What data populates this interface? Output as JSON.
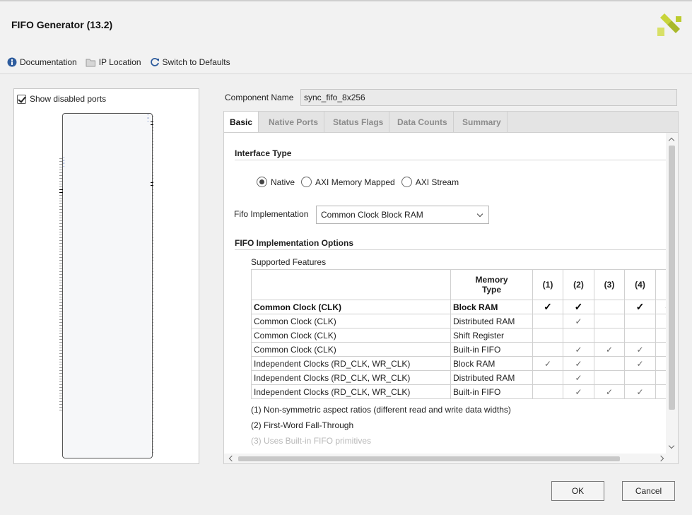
{
  "window": {
    "title": "FIFO Generator (13.2)"
  },
  "toolbar": {
    "documentation": "Documentation",
    "ip_location": "IP Location",
    "switch_defaults": "Switch to Defaults"
  },
  "left_panel": {
    "show_disabled_ports": "Show disabled ports",
    "show_disabled_checked": true
  },
  "component": {
    "label": "Component Name",
    "value": "sync_fifo_8x256"
  },
  "tabs": [
    "Basic",
    "Native Ports",
    "Status Flags",
    "Data Counts",
    "Summary"
  ],
  "basic": {
    "interface_type_title": "Interface Type",
    "interface_options": [
      "Native",
      "AXI Memory Mapped",
      "AXI Stream"
    ],
    "interface_selected": "Native",
    "impl_label": "Fifo Implementation",
    "impl_value": "Common Clock Block RAM",
    "options_title": "FIFO Implementation Options",
    "supported_features": "Supported Features",
    "table": {
      "headers": [
        "",
        "Memory",
        "Type",
        "(1)",
        "(2)",
        "(3)",
        "(4)",
        "("
      ],
      "rows": [
        {
          "clock": "Common Clock (CLK)",
          "memory": "Block RAM",
          "c1": "✓",
          "c2": "✓",
          "c3": "",
          "c4": "✓",
          "c5": "✓"
        },
        {
          "clock": "Common Clock (CLK)",
          "memory": "Distributed RAM",
          "c1": "",
          "c2": "✓",
          "c3": "",
          "c4": "",
          "c5": ""
        },
        {
          "clock": "Common Clock (CLK)",
          "memory": "Shift Register",
          "c1": "",
          "c2": "",
          "c3": "",
          "c4": "",
          "c5": ""
        },
        {
          "clock": "Common Clock (CLK)",
          "memory": "Built-in FIFO",
          "c1": "",
          "c2": "✓",
          "c3": "✓",
          "c4": "✓",
          "c5": ""
        },
        {
          "clock": "Independent Clocks (RD_CLK, WR_CLK)",
          "memory": "Block RAM",
          "c1": "✓",
          "c2": "✓",
          "c3": "",
          "c4": "✓",
          "c5": ""
        },
        {
          "clock": "Independent Clocks (RD_CLK, WR_CLK)",
          "memory": "Distributed RAM",
          "c1": "",
          "c2": "✓",
          "c3": "",
          "c4": "",
          "c5": ""
        },
        {
          "clock": "Independent Clocks (RD_CLK, WR_CLK)",
          "memory": "Built-in FIFO",
          "c1": "",
          "c2": "✓",
          "c3": "✓",
          "c4": "✓",
          "c5": ""
        }
      ]
    },
    "notes": [
      "(1) Non-symmetric aspect ratios (different read and write data widths)",
      "(2) First-Word Fall-Through",
      "(3) Uses Built-in FIFO primitives"
    ]
  },
  "buttons": {
    "ok": "OK",
    "cancel": "Cancel"
  },
  "colors": {
    "logo": "#c3d22f",
    "accent_blue": "#2f5d9e"
  }
}
